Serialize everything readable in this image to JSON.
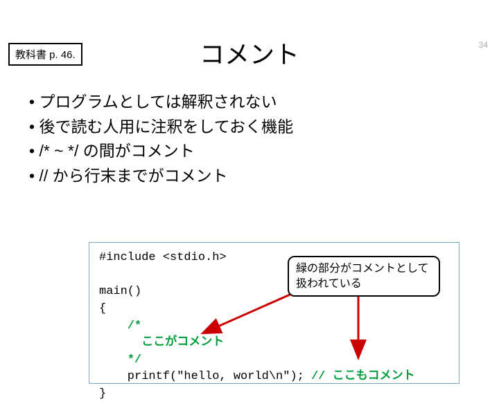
{
  "page_number": "34",
  "textbook_ref": "教科書 p. 46.",
  "title": "コメント",
  "bullets": [
    "プログラムとしては解釈されない",
    "後で読む人用に注釈をしておく機能",
    "/* ~ */ の間がコメント",
    "// から行末までがコメント"
  ],
  "code": {
    "line1": "#include <stdio.h>",
    "blank1": "",
    "line2": "main()",
    "line3": "{",
    "line4a": "    ",
    "line4b": "/*",
    "line5a": "      ",
    "line5b": "ここがコメント",
    "line6a": "    ",
    "line6b": "*/",
    "line7a": "    printf(\"hello, world\\n\"); ",
    "line7b": "// ここもコメント",
    "line8": "}"
  },
  "callout": "緑の部分がコメントとして扱われている"
}
